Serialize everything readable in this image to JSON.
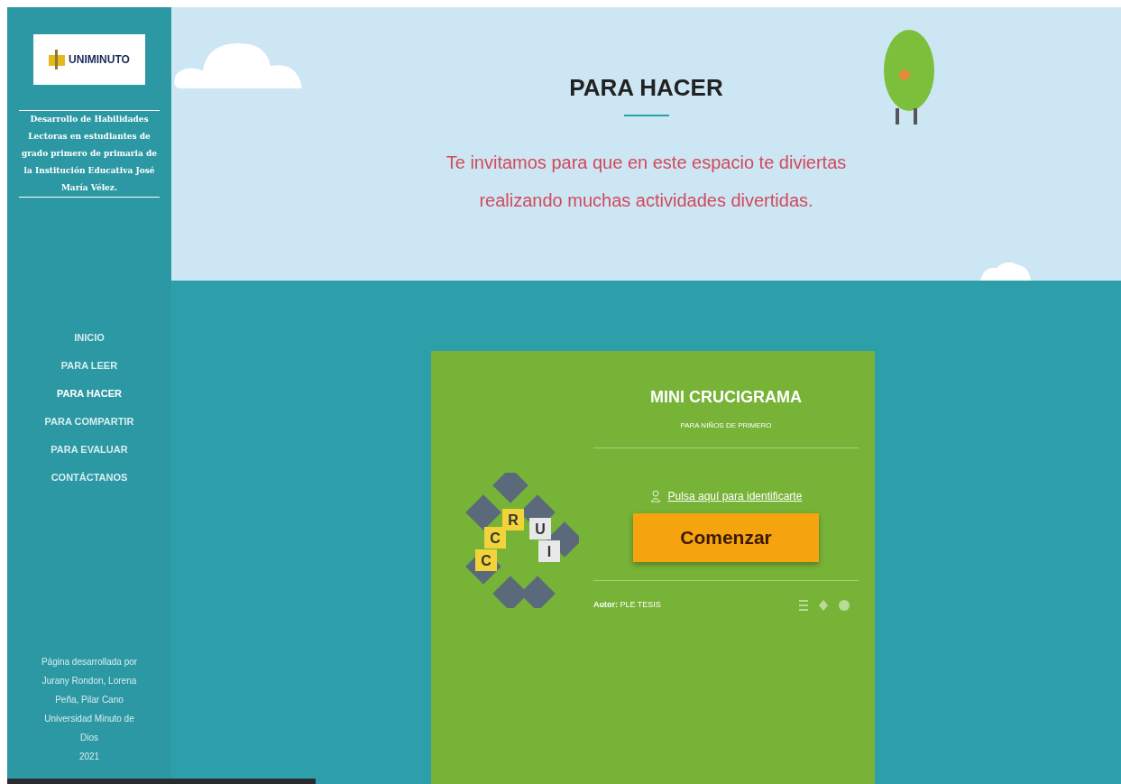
{
  "sidebar": {
    "logo_text": "UNIMINUTO",
    "site_title": "Desarrollo de Habilidades Lectoras en estudiantes de grado primero de primaria de la Institución Educativa José María Vélez.",
    "nav": [
      {
        "label": "INICIO",
        "selected": false
      },
      {
        "label": "PARA LEER",
        "selected": false
      },
      {
        "label": "PARA HACER",
        "selected": true
      },
      {
        "label": "PARA COMPARTIR",
        "selected": false
      },
      {
        "label": "PARA EVALUAR",
        "selected": false
      },
      {
        "label": "CONTÁCTANOS",
        "selected": false
      }
    ],
    "footer_lines": [
      "Página desarrollada por",
      "Jurany Rondon, Lorena",
      "Peña, Pilar Cano",
      "Universidad Minuto de",
      "Dios",
      "2021"
    ]
  },
  "header": {
    "title": "PARA HACER",
    "subtitle": "Te invitamos para que en este espacio te diviertas realizando muchas actividades divertidas."
  },
  "activity": {
    "logo_letters": [
      "C",
      "R",
      "U",
      "I",
      "C"
    ],
    "title": "MINI CRUCIGRAMA",
    "subtitle": "PARA NIÑOS DE PRIMERO",
    "login_link": "Pulsa aquí para identificarte",
    "start_button": "Comenzar",
    "author": "**Autor:** PLE TESIS"
  }
}
